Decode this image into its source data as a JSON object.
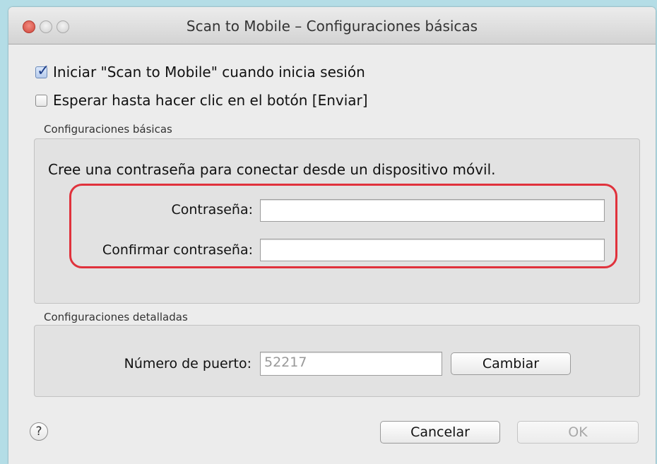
{
  "window": {
    "title": "Scan to Mobile – Configuraciones básicas"
  },
  "options": {
    "start_on_login": {
      "label": "Iniciar \"Scan to Mobile\" cuando inicia sesión",
      "checked": true
    },
    "wait_for_send": {
      "label": "Esperar hasta hacer clic en el botón [Enviar]",
      "checked": false
    }
  },
  "basic_settings": {
    "group_label": "Configuraciones básicas",
    "instruction": "Cree una contraseña para conectar desde un dispositivo móvil.",
    "password_label": "Contraseña:",
    "password_value": "",
    "confirm_label": "Confirmar contraseña:",
    "confirm_value": ""
  },
  "detailed_settings": {
    "group_label": "Configuraciones detalladas",
    "port_label": "Número de puerto:",
    "port_value": "52217",
    "change_button": "Cambiar"
  },
  "footer": {
    "help_symbol": "?",
    "cancel_button": "Cancelar",
    "ok_button": "OK"
  }
}
